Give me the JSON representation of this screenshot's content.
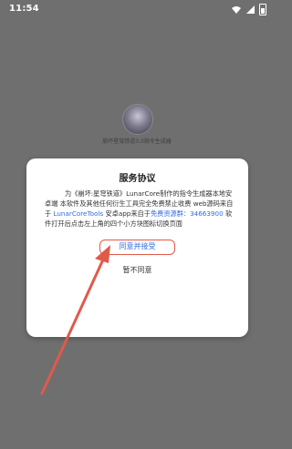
{
  "status_bar": {
    "time": "11:54",
    "icons": [
      "wifi-icon",
      "signal-icon",
      "battery-icon"
    ]
  },
  "app": {
    "subtitle": "崩坏星穹铁道3.0指令生成器"
  },
  "dialog": {
    "title": "服务协议",
    "body": {
      "text_1": "为《崩坏:星穹铁道》LunarCore制作的指令生成器本地安卓端 本软件及其他任何衍生工具完全免费禁止收费 web源码来自于 ",
      "link_1": "LunarCoreTools",
      "text_2": " 安卓app来自于",
      "link_2": "免费资源群：34663900",
      "text_3": " 软件打开后点击左上角的四个小方块图标切换页面"
    },
    "accept_label": "同意并接受",
    "decline_label": "暂不同意"
  },
  "annotation": {
    "arrow_color": "#e05a4a"
  }
}
